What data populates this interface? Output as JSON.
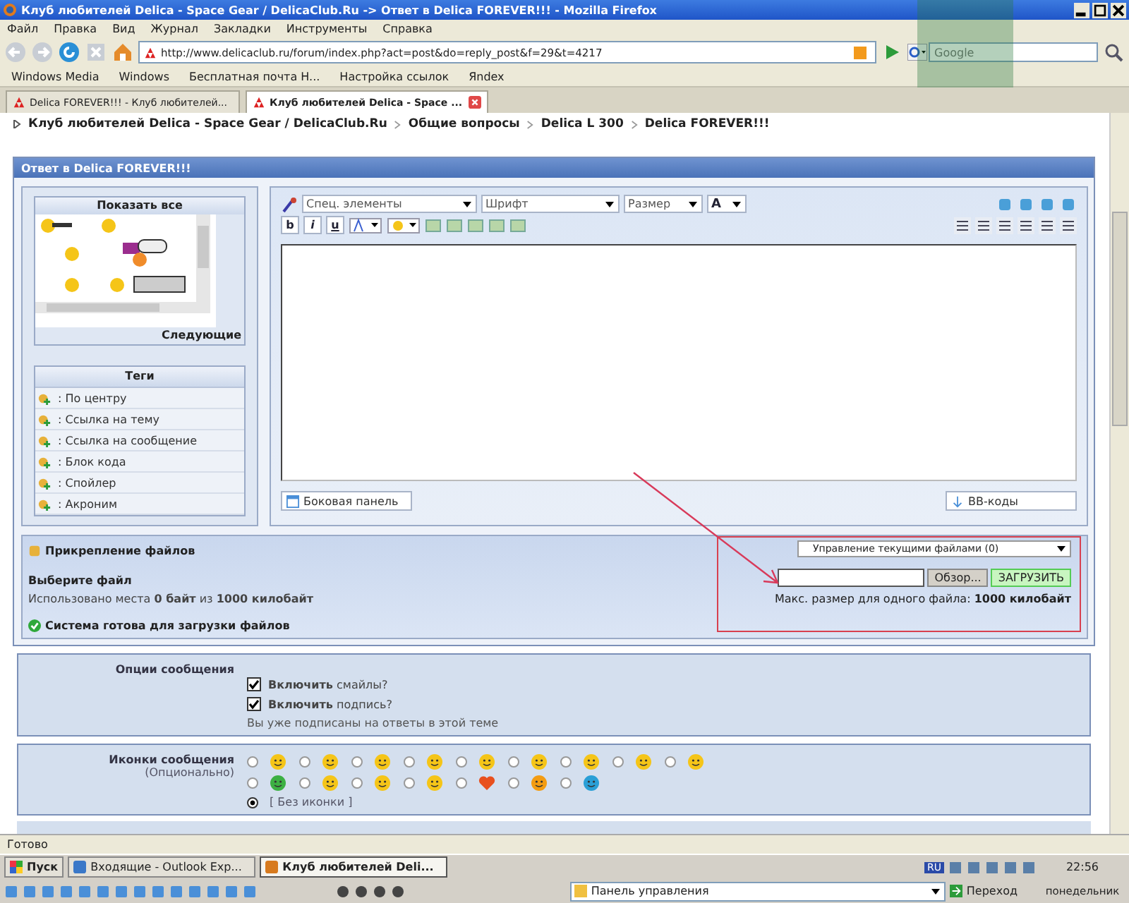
{
  "window": {
    "title": "Клуб любителей Delica - Space Gear / DelicaClub.Ru -> Ответ в Delica FOREVER!!! - Mozilla Firefox"
  },
  "menu": [
    "Файл",
    "Правка",
    "Вид",
    "Журнал",
    "Закладки",
    "Инструменты",
    "Справка"
  ],
  "nav": {
    "url": "http://www.delicaclub.ru/forum/index.php?act=post&do=reply_post&f=29&t=4217",
    "search_placeholder": "Google"
  },
  "bookmarks": [
    "Windows Media",
    "Windows",
    "Бесплатная почта H...",
    "Настройка ссылок",
    "Яndex"
  ],
  "tabs": [
    {
      "label": "Delica FOREVER!!! - Клуб любителей...",
      "selected": false
    },
    {
      "label": "Клуб любителей Delica - Space ...",
      "selected": true
    }
  ],
  "breadcrumb": [
    "Клуб любителей Delica - Space Gear / DelicaClub.Ru",
    "Общие вопросы",
    "Delica L 300",
    "Delica FOREVER!!!"
  ],
  "panel": {
    "title": "Ответ в Delica FOREVER!!!",
    "emoticons": {
      "show_all": "Показать все",
      "next": "Следующие"
    },
    "tags": {
      "title": "Теги",
      "items": [
        ": По центру",
        ": Ссылка на тему",
        ": Ссылка на сообщение",
        ": Блок кода",
        ": Спойлер",
        ": Акроним"
      ]
    },
    "selects": [
      "Спец. элементы",
      "Шрифт",
      "Размер",
      "A"
    ],
    "format_buttons": [
      "b",
      "i",
      "u"
    ],
    "sidebar_button": "Боковая панель",
    "bbcode_button": "BB-коды"
  },
  "attachments": {
    "title": "Прикрепление файлов",
    "choose": "Выберите файл",
    "usage": "Использовано места **0 байт** из **1000 килобайт**",
    "status": "Система готова для загрузки файлов",
    "manage_select": "Управление текущими файлами (0)",
    "browse_button": "Обзор...",
    "upload_button": "ЗАГРУЗИТЬ",
    "max_size": "Макс. размер для одного файла: **1000 килобайт**"
  },
  "options": {
    "label": "Опции сообщения",
    "checks": [
      {
        "text": "**Включить** смайлы?",
        "checked": true
      },
      {
        "text": "**Включить** подпись?",
        "checked": true
      }
    ],
    "note": "Вы уже подписаны на ответы в этой теме"
  },
  "icons": {
    "label": "Иконки сообщения",
    "sublabel": "(Опционально)",
    "choices": [
      {
        "kind": "face",
        "color": "#f5c518",
        "selected": false
      },
      {
        "kind": "face",
        "color": "#f5c518",
        "selected": false
      },
      {
        "kind": "face",
        "color": "#f5c518",
        "selected": false
      },
      {
        "kind": "face",
        "color": "#f5c518",
        "selected": false
      },
      {
        "kind": "face",
        "color": "#f5c518",
        "selected": false
      },
      {
        "kind": "face",
        "color": "#f5c518",
        "selected": false
      },
      {
        "kind": "face",
        "color": "#f5c518",
        "selected": false
      },
      {
        "kind": "face",
        "color": "#f5c518",
        "selected": false
      },
      {
        "kind": "face",
        "color": "#f5c518",
        "selected": false
      },
      {
        "kind": "face",
        "color": "#3cb043",
        "selected": false
      },
      {
        "kind": "face",
        "color": "#f5c518",
        "selected": false
      },
      {
        "kind": "face",
        "color": "#f5c518",
        "selected": false
      },
      {
        "kind": "face",
        "color": "#f5c518",
        "selected": false
      },
      {
        "kind": "heart",
        "color": "#e8501e",
        "selected": false
      },
      {
        "kind": "face",
        "color": "#f39c12",
        "selected": false
      },
      {
        "kind": "face",
        "color": "#2a9fd6",
        "selected": false
      }
    ],
    "none": {
      "label": "[ Без иконки ]",
      "selected": true
    }
  },
  "status_bar": "Готово",
  "taskbar": {
    "start": "Пуск",
    "tasks": [
      {
        "label": "Входящие - Outlook Exp...",
        "selected": false
      },
      {
        "label": "Клуб любителей Deli...",
        "selected": true
      }
    ],
    "address": "Панель управления",
    "go": "Переход",
    "lang": "RU",
    "clock": "22:56",
    "day": "понедельник"
  }
}
